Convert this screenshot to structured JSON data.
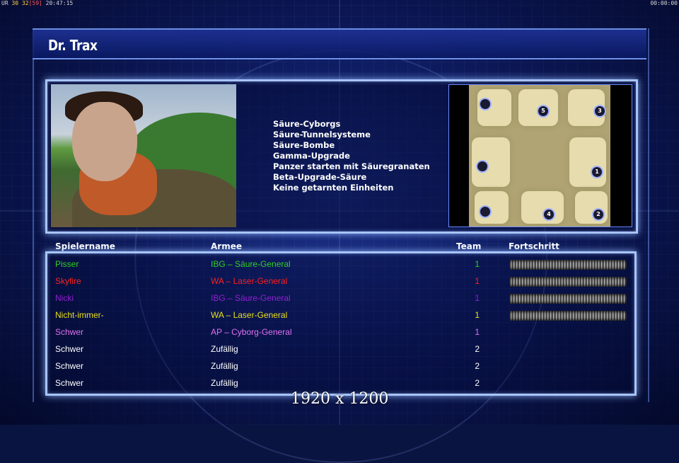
{
  "topbar": {
    "stat_prefix": "UR",
    "stat_a": "30",
    "stat_b": "32",
    "stat_c": "[59]",
    "time": "20:47:15",
    "clock_right": "00:00:00"
  },
  "screen": {
    "title": "Dr. Trax"
  },
  "general": {
    "features": [
      "Säure-Cyborgs",
      "Säure-Tunnelsysteme",
      "Säure-Bombe",
      "Gamma-Upgrade",
      "Panzer starten mit Säuregranaten",
      "Beta-Upgrade-Säure",
      "Keine getarnten Einheiten"
    ]
  },
  "minimap": {
    "spawn_labels": [
      "",
      "5",
      "3",
      "",
      "1",
      "",
      "4",
      "2"
    ]
  },
  "table": {
    "headers": {
      "name": "Spielername",
      "army": "Armee",
      "team": "Team",
      "progress": "Fortschritt"
    },
    "rows": [
      {
        "name": "Pisser",
        "army": "IBG – Säure-General",
        "team": "1",
        "color": "#30d020",
        "progress": 1.0
      },
      {
        "name": "Skyfire",
        "army": "WA – Laser-General",
        "team": "1",
        "color": "#ff2020",
        "progress": 1.0
      },
      {
        "name": "Nicki",
        "army": "IBG – Säure-General",
        "team": "1",
        "color": "#9020d0",
        "progress": 1.0
      },
      {
        "name": "Nicht-immer-",
        "army": "WA – Laser-General",
        "team": "1",
        "color": "#e8e020",
        "progress": 1.0
      },
      {
        "name": "Schwer",
        "army": "AP – Cyborg-General",
        "team": "1",
        "color": "#e070f0",
        "progress": null
      },
      {
        "name": "Schwer",
        "army": "Zufällig",
        "team": "2",
        "color": "#ffffff",
        "progress": null
      },
      {
        "name": "Schwer",
        "army": "Zufällig",
        "team": "2",
        "color": "#ffffff",
        "progress": null
      },
      {
        "name": "Schwer",
        "army": "Zufällig",
        "team": "2",
        "color": "#ffffff",
        "progress": null
      }
    ]
  },
  "watermark": "1920 x 1200"
}
